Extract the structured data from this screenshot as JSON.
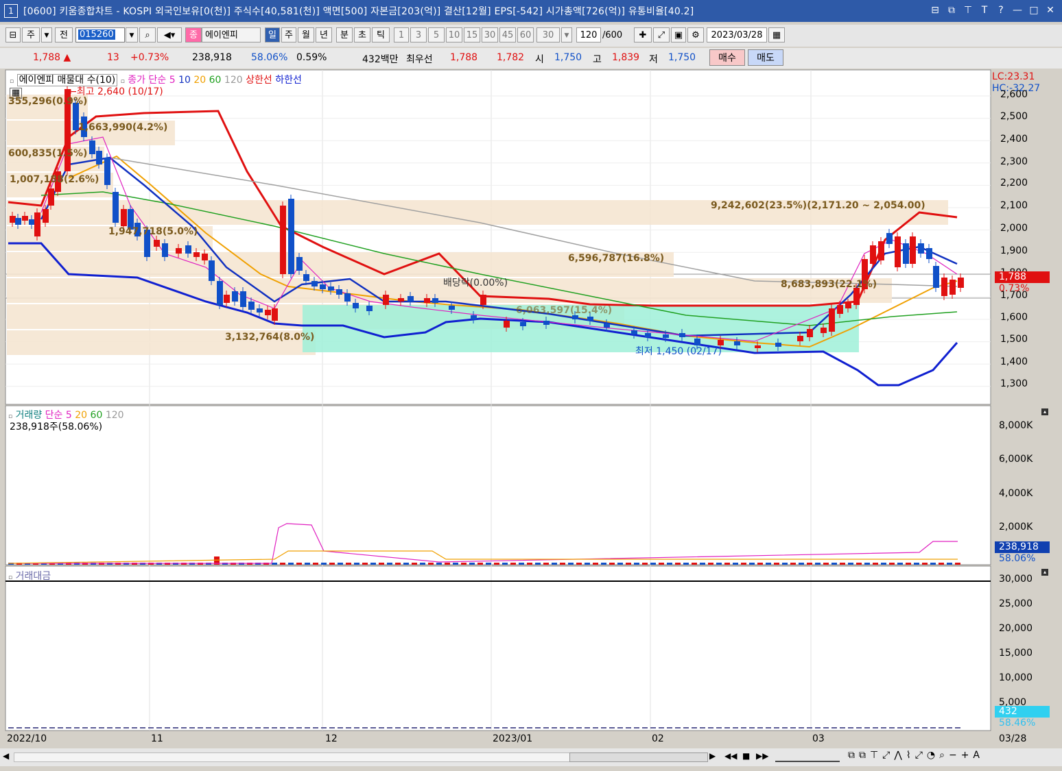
{
  "window": {
    "number": "1",
    "title": "[0600] 키움종합차트 - KOSPI 외국인보유[0(천)] 주식수[40,581(천)] 액면[500] 자본금[203(억)] 결산[12월] EPS[-542] 시가총액[726(억)] 유통비율[40.2]",
    "buttons": [
      "⊟",
      "⧉",
      "⊤",
      "T",
      "?",
      "—",
      "□",
      "✕"
    ]
  },
  "toolbar": {
    "type1": "주",
    "type2": "전",
    "code": "015260",
    "name_prefix": "종",
    "name": "에이엔피",
    "periods": [
      "일",
      "주",
      "월",
      "년",
      "분",
      "초",
      "틱"
    ],
    "selected_period": "일",
    "intervals": [
      "1",
      "3",
      "5",
      "10",
      "15",
      "30",
      "45",
      "60"
    ],
    "interval_value": "30",
    "count": "120",
    "count_total": "/600",
    "date": "2023/03/28"
  },
  "quote": {
    "price": "1,788 ▲",
    "change": "13",
    "change_pct": "+0.73%",
    "volume": "238,918",
    "vol_ratio": "58.06%",
    "turnover": "0.59%",
    "amount": "432백만",
    "best_label": "최우선",
    "ask": "1,788",
    "bid": "1,782",
    "open_label": "시",
    "open": "1,750",
    "high_label": "고",
    "high": "1,839",
    "low_label": "저",
    "low": "1,750",
    "buy": "매수",
    "sell": "매도"
  },
  "price_panel": {
    "legend_name": "에이엔피 매물대 수(10)",
    "legend_close": "종가 단순",
    "ma": [
      "5",
      "10",
      "20",
      "60",
      "120"
    ],
    "upper": "상한선",
    "lower": "하한선",
    "lc": "LC:23.31",
    "hc": "HC:-32.27",
    "high_note": "←최고 2,640 (10/17)",
    "low_note": "최저 1,450 (02/17)",
    "dividend_note": "배당락(0.00%)",
    "current_price": "1,788",
    "current_pct": "0.73%",
    "volume_profile": [
      "355,296(0.9%)",
      "1,663,990(4.2%)",
      "600,835(1.5%)",
      "1,007,188(2.6%)",
      "9,242,602(23.5%)(2,171.20 ~ 2,054.00)",
      "1,947,718(5.0%)",
      "6,596,787(16.8%)",
      "8,683,893(22.1%)",
      "6,063,597(15.4%)",
      "3,132,764(8.0%)"
    ],
    "yticks": [
      "2,600",
      "2,500",
      "2,400",
      "2,300",
      "2,200",
      "2,100",
      "2,000",
      "1,900",
      "1,800",
      "1,700",
      "1,600",
      "1,500",
      "1,400",
      "1,300"
    ]
  },
  "volume_panel": {
    "legend": "거래량",
    "legend_ma": "단순",
    "ma": [
      "5",
      "20",
      "60",
      "120"
    ],
    "current": "238,918주(58.06%)",
    "badge": "238,918",
    "badge_pct": "58.06%",
    "yticks": [
      "8,000K",
      "6,000K",
      "4,000K",
      "2,000K"
    ]
  },
  "amount_panel": {
    "legend": "거래대금",
    "badge": "432",
    "badge_pct": "58.46%",
    "yticks": [
      "30,000",
      "25,000",
      "20,000",
      "15,000",
      "10,000",
      "5,000"
    ]
  },
  "xaxis": [
    "2022/10",
    "11",
    "12",
    "2023/01",
    "02",
    "03",
    "03/28"
  ],
  "colors": {
    "up": "#e01010",
    "down": "#1050c8",
    "ma5": "#e020c0",
    "ma10": "#1030c0",
    "ma20": "#f0a000",
    "ma60": "#20a020",
    "ma120": "#a0a0a0",
    "upper": "#e01010",
    "lower": "#1020d0",
    "profile": "#f5e6d2",
    "highlight": "#9ff0d8"
  }
}
